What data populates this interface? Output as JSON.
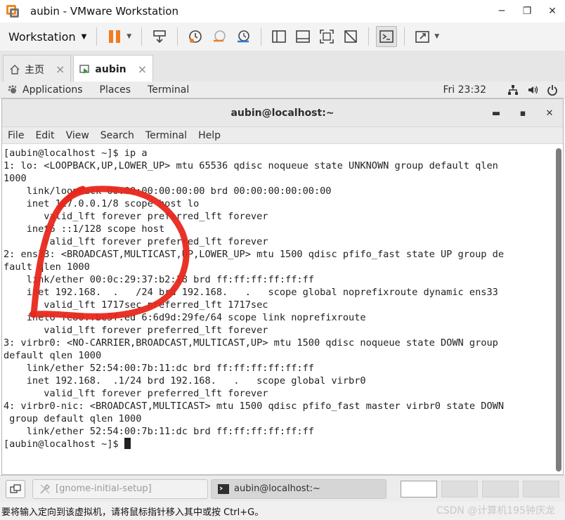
{
  "vmware": {
    "title": "aubin - VMware Workstation",
    "menu_label": "Workstation",
    "window_controls": {
      "minimize": "─",
      "restore": "❐",
      "close": "✕"
    }
  },
  "tabs": [
    {
      "label": "主页",
      "icon": "home-icon",
      "close": "×"
    },
    {
      "label": "aubin",
      "icon": "vm-running-icon",
      "close": "×"
    }
  ],
  "gnome_bar": {
    "applications": "Applications",
    "places": "Places",
    "terminal": "Terminal",
    "clock": "Fri 23:32"
  },
  "terminal": {
    "title": "aubin@localhost:~",
    "controls": {
      "minimize": "▬",
      "maximize": "▪",
      "close": "✕"
    },
    "menu": [
      "File",
      "Edit",
      "View",
      "Search",
      "Terminal",
      "Help"
    ],
    "lines": [
      "[aubin@localhost ~]$ ip a",
      "1: lo: <LOOPBACK,UP,LOWER_UP> mtu 65536 qdisc noqueue state UNKNOWN group default qlen",
      "1000",
      "    link/loopback 00:00:00:00:00:00 brd 00:00:00:00:00:00",
      "    inet 127.0.0.1/8 scope host lo",
      "       valid_lft forever preferred_lft forever",
      "    inet6 ::1/128 scope host",
      "       valid_lft forever preferred_lft forever",
      "2: ens33: <BROADCAST,MULTICAST,UP,LOWER_UP> mtu 1500 qdisc pfifo_fast state UP group de",
      "fault qlen 1000",
      "    link/ether 00:0c:29:37:b2:18 brd ff:ff:ff:ff:ff:ff",
      "    inet 192.168.  .   /24 brd 192.168.   .   scope global noprefixroute dynamic ens33",
      "       valid_lft 1717sec preferred_lft 1717sec",
      "    inet6 fe80::be5f:ed 6:6d9d:29fe/64 scope link noprefixroute",
      "       valid_lft forever preferred_lft forever",
      "3: virbr0: <NO-CARRIER,BROADCAST,MULTICAST,UP> mtu 1500 qdisc noqueue state DOWN group",
      "default qlen 1000",
      "    link/ether 52:54:00:7b:11:dc brd ff:ff:ff:ff:ff:ff",
      "    inet 192.168.  .1/24 brd 192.168.   .   scope global virbr0",
      "       valid_lft forever preferred_lft forever",
      "4: virbr0-nic: <BROADCAST,MULTICAST> mtu 1500 qdisc pfifo_fast master virbr0 state DOWN",
      " group default qlen 1000",
      "    link/ether 52:54:00:7b:11:dc brd ff:ff:ff:ff:ff:ff",
      "[aubin@localhost ~]$ "
    ]
  },
  "bottom_bar": {
    "task_inactive": "[gnome-initial-setup]",
    "task_active": "aubin@localhost:~"
  },
  "status_bar": {
    "text": "要将输入定向到该虚拟机，请将鼠标指针移入其中或按 Ctrl+G。",
    "watermark": "CSDN @计算机195钟庆龙"
  },
  "colors": {
    "accent_orange": "#f07b22",
    "annotation_red": "#e8281c"
  }
}
